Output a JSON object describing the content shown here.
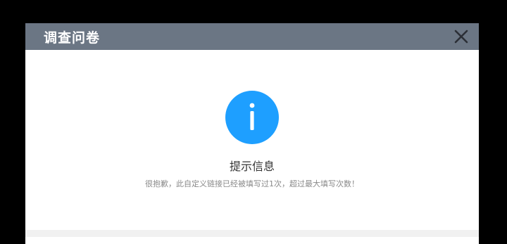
{
  "dialog": {
    "title": "调查问卷",
    "close_icon": "close-icon"
  },
  "notice": {
    "icon": "info-icon",
    "heading": "提示信息",
    "message": "很抱歉，此自定义链接已经被填写过1次，超过最大填写次数！"
  },
  "colors": {
    "titlebar": "#6b7684",
    "accent": "#1e9fff",
    "background": "#000000"
  }
}
